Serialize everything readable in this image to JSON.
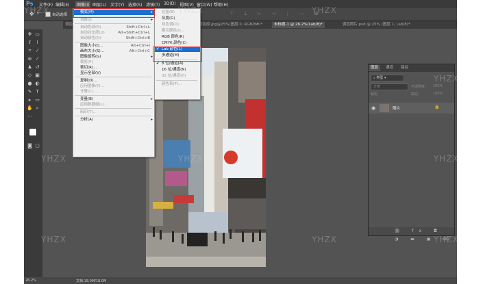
{
  "app": {
    "logo": "Ps"
  },
  "menubar": [
    "文件(F)",
    "编辑(E)",
    "图像(I)",
    "图层(L)",
    "文字(Y)",
    "选择(S)",
    "滤镜(T)",
    "3D(D)",
    "视图(V)",
    "窗口(W)",
    "帮助(H)"
  ],
  "options": {
    "auto_select": "自动选择"
  },
  "doc_tabs": [
    "调色度完.jpg",
    "调色原.jpg@25%(图层 0, RGB/8#)*",
    "未标题-1 @ 26.2%(Lab/8)*",
    "调色照片.psd @ 25% (图层 1, Lab/8)*"
  ],
  "image_menu": [
    {
      "label": "模式(M)",
      "shortcut": "",
      "arrow": "▸",
      "state": "hl"
    },
    {
      "sep": true
    },
    {
      "label": "调整(J)",
      "shortcut": "",
      "arrow": "▸",
      "state": "dis"
    },
    {
      "sep": true
    },
    {
      "label": "自动色调(N)",
      "shortcut": "Shift+Ctrl+L",
      "arrow": "",
      "state": "dis"
    },
    {
      "label": "自动对比度(U)",
      "shortcut": "Alt+Shift+Ctrl+L",
      "arrow": "",
      "state": "dis"
    },
    {
      "label": "自动颜色(O)",
      "shortcut": "Shift+Ctrl+B",
      "arrow": "",
      "state": "dis"
    },
    {
      "sep": true
    },
    {
      "label": "图像大小(I)...",
      "shortcut": "Alt+Ctrl+I",
      "arrow": "",
      "state": ""
    },
    {
      "label": "画布大小(S)...",
      "shortcut": "Alt+Ctrl+C",
      "arrow": "",
      "state": ""
    },
    {
      "label": "图像旋转(G)",
      "shortcut": "",
      "arrow": "▸",
      "state": ""
    },
    {
      "label": "裁剪(P)",
      "shortcut": "",
      "arrow": "",
      "state": "dis"
    },
    {
      "label": "裁切(R)...",
      "shortcut": "",
      "arrow": "",
      "state": ""
    },
    {
      "label": "显示全部(V)",
      "shortcut": "",
      "arrow": "",
      "state": ""
    },
    {
      "sep": true
    },
    {
      "label": "复制(D)...",
      "shortcut": "",
      "arrow": "",
      "state": ""
    },
    {
      "label": "应用图像(Y)...",
      "shortcut": "",
      "arrow": "",
      "state": "dis"
    },
    {
      "label": "计算(C)...",
      "shortcut": "",
      "arrow": "",
      "state": "dis"
    },
    {
      "sep": true
    },
    {
      "label": "变量(B)",
      "shortcut": "",
      "arrow": "▸",
      "state": ""
    },
    {
      "label": "应用数据组(L)...",
      "shortcut": "",
      "arrow": "",
      "state": "dis"
    },
    {
      "sep": true
    },
    {
      "label": "陷印(T)...",
      "shortcut": "",
      "arrow": "",
      "state": "dis"
    },
    {
      "sep": true
    },
    {
      "label": "分析(A)",
      "shortcut": "",
      "arrow": "▸",
      "state": ""
    }
  ],
  "mode_menu": [
    {
      "label": "位图(B)",
      "check": "",
      "state": "dis"
    },
    {
      "label": "灰度(G)",
      "check": "",
      "state": ""
    },
    {
      "label": "双色调(D)",
      "check": "",
      "state": "dis"
    },
    {
      "label": "索引颜色(I)...",
      "check": "",
      "state": "dis"
    },
    {
      "label": "RGB 颜色(R)",
      "check": "",
      "state": ""
    },
    {
      "label": "CMYK 颜色(C)",
      "check": "",
      "state": ""
    },
    {
      "label": "Lab 颜色(L)",
      "check": "✔",
      "state": "hl"
    },
    {
      "label": "多通道(M)",
      "check": "",
      "state": ""
    },
    {
      "sep": true
    },
    {
      "label": "8 位/通道(A)",
      "check": "✔",
      "state": ""
    },
    {
      "label": "16 位/通道(N)",
      "check": "",
      "state": ""
    },
    {
      "label": "32 位/通道(H)",
      "check": "",
      "state": "dis"
    },
    {
      "sep": true
    },
    {
      "label": "颜色表(T)...",
      "check": "",
      "state": "dis"
    }
  ],
  "layers_panel": {
    "tabs": [
      "图层",
      "通道",
      "路径"
    ],
    "kind": "类型",
    "blend": "正常",
    "opacity_label": "不透明度:",
    "opacity": "100%",
    "lock_label": "锁定:",
    "fill_label": "填充:",
    "fill": "100%",
    "layer_name": "照片"
  },
  "status": {
    "zoom": "26.2%",
    "doc": "文档:18.0M/18.0M"
  },
  "watermark": "YHZX"
}
